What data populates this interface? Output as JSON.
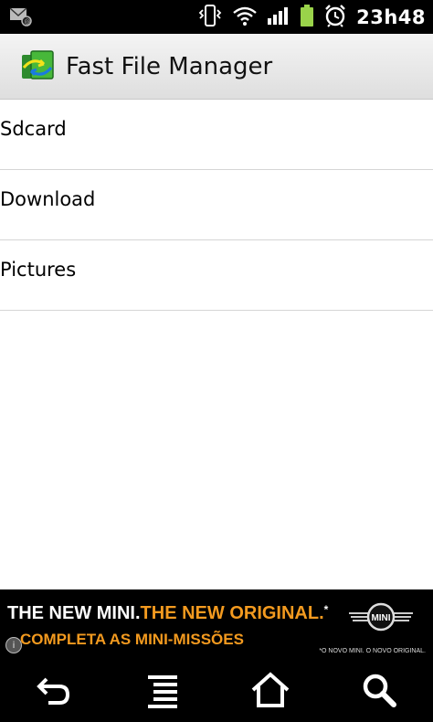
{
  "status_bar": {
    "time": "23h48",
    "icons": [
      "email-notification-icon",
      "vibrate-icon",
      "wifi-icon",
      "signal-icon",
      "battery-icon",
      "alarm-icon"
    ]
  },
  "app": {
    "title": "Fast File Manager",
    "icon": "app-logo-icon"
  },
  "list": {
    "items": [
      {
        "label": "Sdcard"
      },
      {
        "label": "Download"
      },
      {
        "label": "Pictures"
      }
    ]
  },
  "ad": {
    "line1_white": "THE NEW MINI.",
    "line1_orange": "THE NEW ORIGINAL.",
    "line1_mark": "*",
    "line2": "COMPLETA AS MINI-MISSÕES",
    "fine_print": "*O NOVO MINI. O NOVO ORIGINAL.",
    "brand": "MINI",
    "info_glyph": "i"
  },
  "nav_bar": {
    "buttons": [
      "back-icon",
      "menu-icon",
      "home-icon",
      "search-icon"
    ]
  },
  "colors": {
    "ad_accent": "#f39a1f",
    "status_bar_bg": "#000000",
    "battery": "#9ad34a"
  }
}
